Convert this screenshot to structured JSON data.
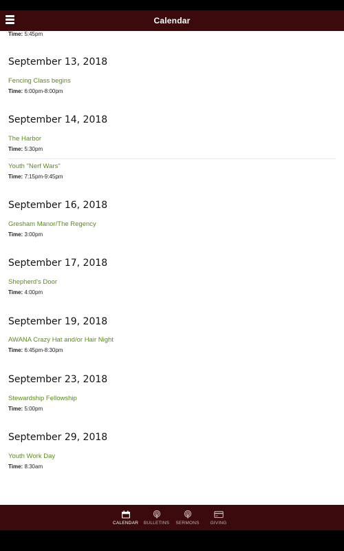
{
  "header": {
    "title": "Calendar",
    "menu_icon": "hamburger-menu-icon"
  },
  "partial_event": {
    "time_label": "Time:",
    "time_value": "5:45pm"
  },
  "days": [
    {
      "date": "September 13, 2018",
      "events": [
        {
          "title": "Fencing Class begins",
          "time_label": "Time:",
          "time": "6:00pm-8:00pm"
        }
      ]
    },
    {
      "date": "September 14, 2018",
      "events": [
        {
          "title": "The Harbor",
          "time_label": "Time:",
          "time": "5:30pm"
        },
        {
          "title": "Youth \"Nerf Wars\"",
          "time_label": "Time:",
          "time": "7:15pm-9:45pm"
        }
      ]
    },
    {
      "date": "September 16, 2018",
      "events": [
        {
          "title": "Gresham Manor/The Regency",
          "time_label": "Time:",
          "time": "3:00pm"
        }
      ]
    },
    {
      "date": "September 17, 2018",
      "events": [
        {
          "title": "Shepherd's Door",
          "time_label": "Time:",
          "time": "4:00pm"
        }
      ]
    },
    {
      "date": "September 19, 2018",
      "events": [
        {
          "title": "AWANA Crazy Hat and/or Hair Night",
          "time_label": "Time:",
          "time": "6:45pm-8:30pm"
        }
      ]
    },
    {
      "date": "September 23, 2018",
      "events": [
        {
          "title": "Stewardship Fellowship",
          "time_label": "Time:",
          "time": "5:00pm"
        }
      ]
    },
    {
      "date": "September 29, 2018",
      "events": [
        {
          "title": "Youth Work Day",
          "time_label": "Time:",
          "time": "8:30am"
        }
      ]
    }
  ],
  "bottom_nav": [
    {
      "label": "CALENDAR",
      "icon": "calendar-icon",
      "active": true
    },
    {
      "label": "BULLETINS",
      "icon": "podcast-icon",
      "active": false
    },
    {
      "label": "SERMONS",
      "icon": "podcast-icon",
      "active": false
    },
    {
      "label": "GIVING",
      "icon": "credit-card-icon",
      "active": false
    }
  ],
  "colors": {
    "bar_background": "#3a0a0c",
    "event_title": "#5a8a1c",
    "active_nav": "#ffffff",
    "inactive_nav": "#c9b3b3"
  }
}
